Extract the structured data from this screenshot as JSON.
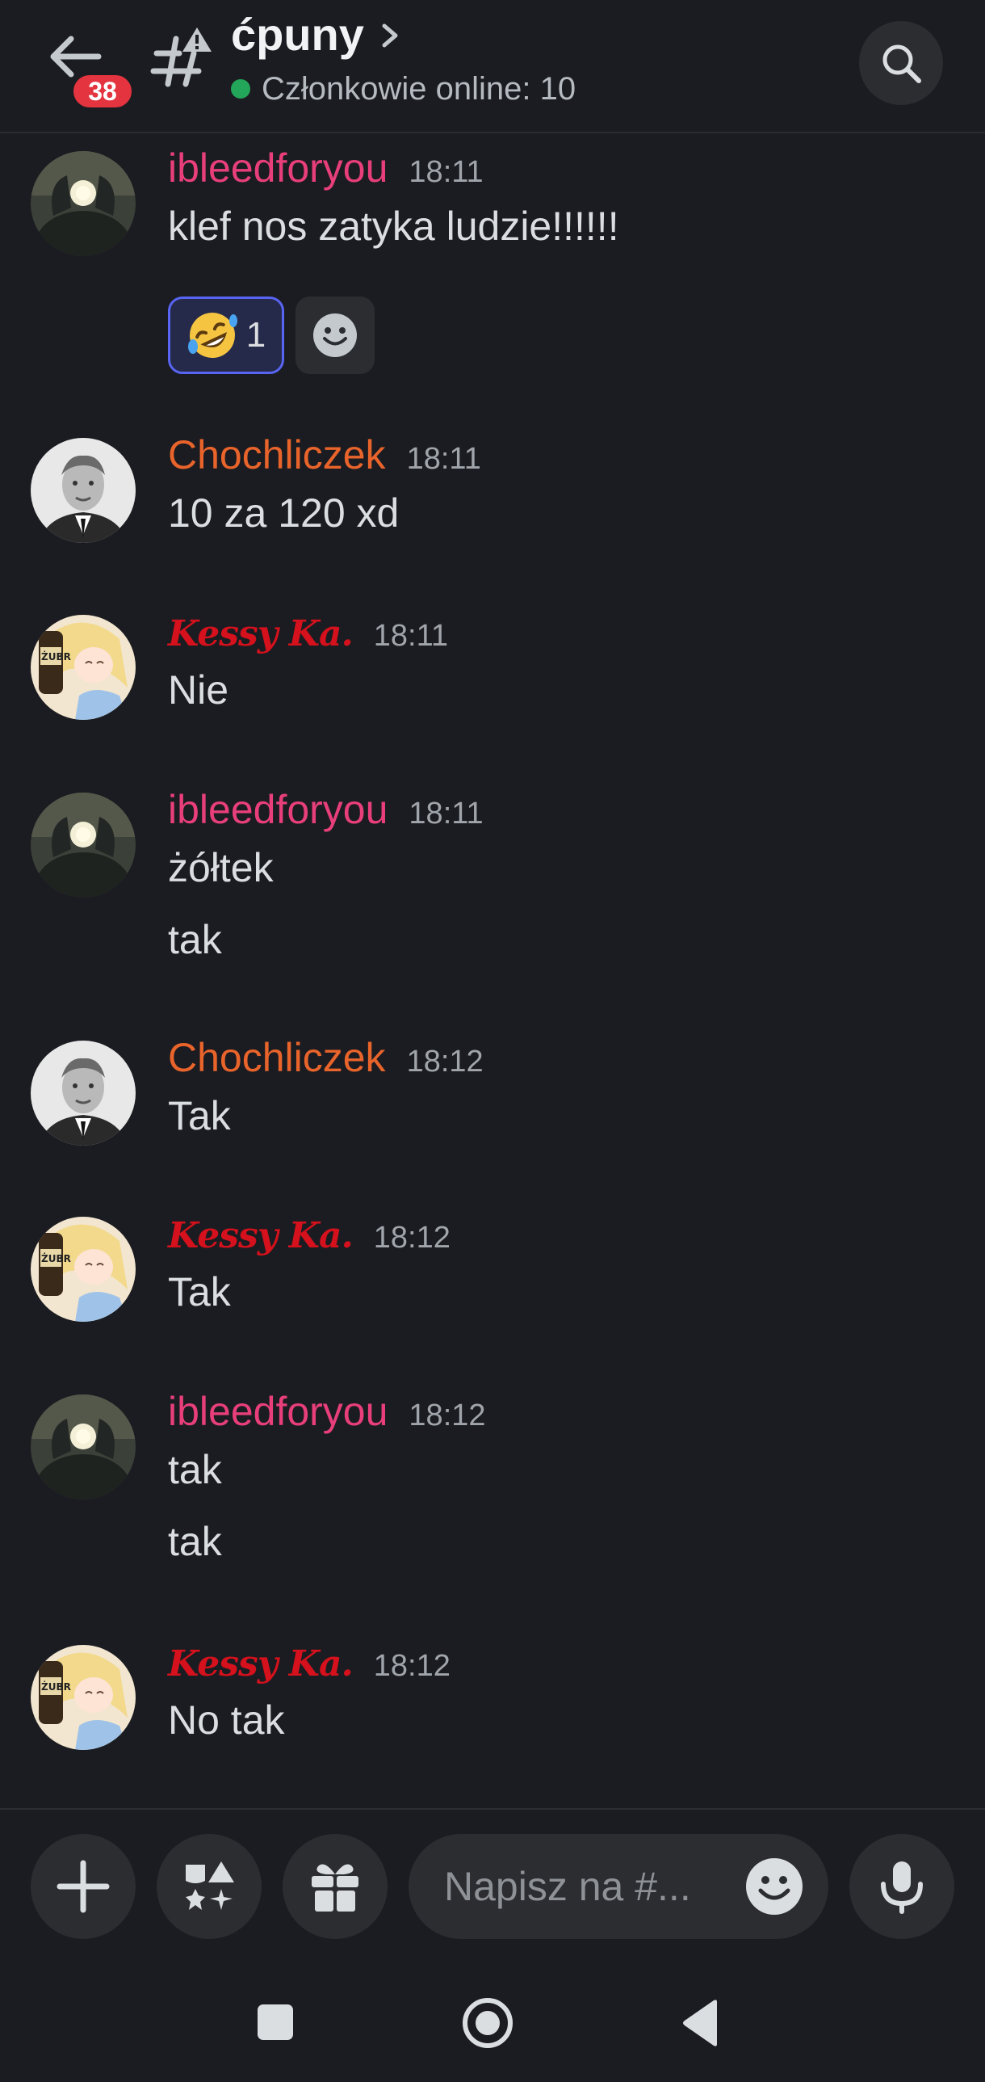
{
  "header": {
    "unread_count": "38",
    "channel_name": "ćpuny",
    "online_text": "Członkowie online: 10"
  },
  "messages": [
    {
      "author": "ibleedforyou",
      "time": "18:11",
      "author_color": "#e83f7a",
      "lines": [
        "klef nos zatyka ludzie!!!!!!"
      ],
      "reaction": {
        "emoji": "rolling-on-floor-laughing",
        "count": "1"
      }
    },
    {
      "author": "Chochliczek",
      "time": "18:11",
      "author_color": "#e8642b",
      "lines": [
        "10 za 120 xd"
      ]
    },
    {
      "author": "Kessy Ka.",
      "time": "18:11",
      "author_color": "#d4111c",
      "lines": [
        "Nie"
      ]
    },
    {
      "author": "ibleedforyou",
      "time": "18:11",
      "author_color": "#e83f7a",
      "lines": [
        "żółtek",
        "tak"
      ]
    },
    {
      "author": "Chochliczek",
      "time": "18:12",
      "author_color": "#e8642b",
      "lines": [
        "Tak"
      ]
    },
    {
      "author": "Kessy Ka.",
      "time": "18:12",
      "author_color": "#d4111c",
      "lines": [
        "Tak"
      ]
    },
    {
      "author": "ibleedforyou",
      "time": "18:12",
      "author_color": "#e83f7a",
      "lines": [
        "tak",
        "tak"
      ]
    },
    {
      "author": "Kessy Ka.",
      "time": "18:12",
      "author_color": "#d4111c",
      "lines": [
        "No tak"
      ]
    }
  ],
  "composer": {
    "placeholder": "Napisz na #..."
  },
  "icons": {
    "back": "arrow-left-icon",
    "channel": "hashtag-warning-icon",
    "search": "search-icon",
    "add": "plus-icon",
    "apps": "apps-icon",
    "gift": "gift-icon",
    "emoji": "smile-icon",
    "mic": "microphone-icon"
  }
}
